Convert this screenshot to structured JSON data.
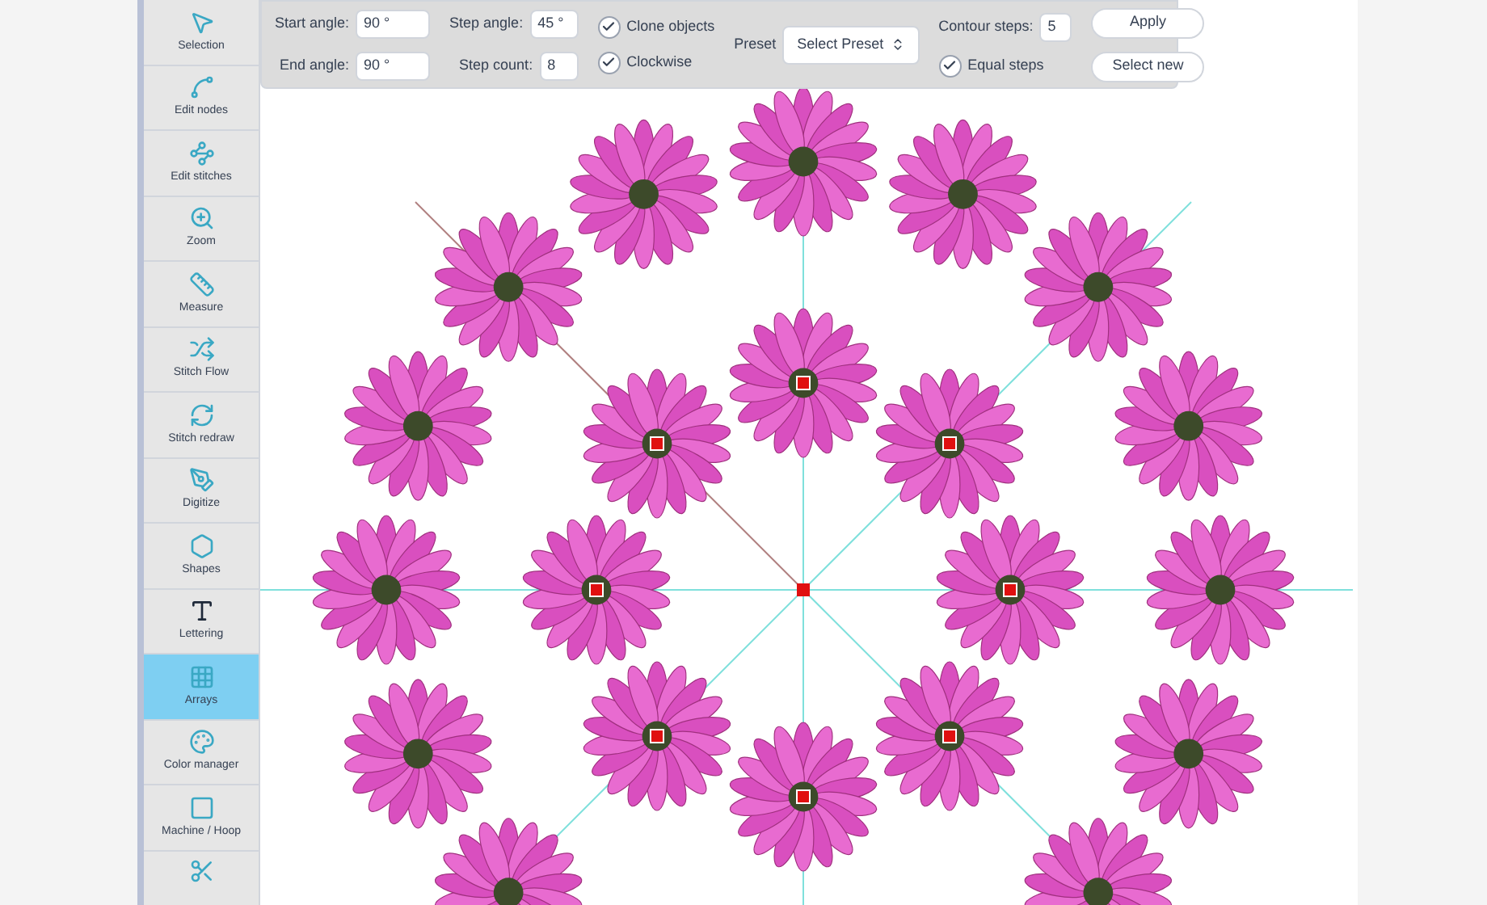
{
  "sidebar": {
    "items": [
      {
        "label": "Selection",
        "selected": false
      },
      {
        "label": "Edit nodes",
        "selected": false
      },
      {
        "label": "Edit stitches",
        "selected": false
      },
      {
        "label": "Zoom",
        "selected": false
      },
      {
        "label": "Measure",
        "selected": false
      },
      {
        "label": "Stitch Flow",
        "selected": false
      },
      {
        "label": "Stitch redraw",
        "selected": false
      },
      {
        "label": "Digitize",
        "selected": false
      },
      {
        "label": "Shapes",
        "selected": false
      },
      {
        "label": "Lettering",
        "selected": false
      },
      {
        "label": "Arrays",
        "selected": true
      },
      {
        "label": "Color manager",
        "selected": false
      },
      {
        "label": "Machine / Hoop",
        "selected": false
      }
    ]
  },
  "options": {
    "start_angle": {
      "label": "Start angle:",
      "value": "90 °"
    },
    "end_angle": {
      "label": "End angle:",
      "value": "90 °"
    },
    "step_angle": {
      "label": "Step angle:",
      "value": "45 °"
    },
    "step_count": {
      "label": "Step count:",
      "value": "8"
    },
    "clone_objects": {
      "label": "Clone objects",
      "checked": true
    },
    "clockwise": {
      "label": "Clockwise",
      "checked": true
    },
    "preset": {
      "label": "Preset",
      "value": "Select Preset"
    },
    "contour_steps": {
      "label": "Contour steps:",
      "value": "5"
    },
    "equal_steps": {
      "label": "Equal steps",
      "checked": true
    },
    "buttons": [
      "Apply",
      "Select new"
    ]
  }
}
